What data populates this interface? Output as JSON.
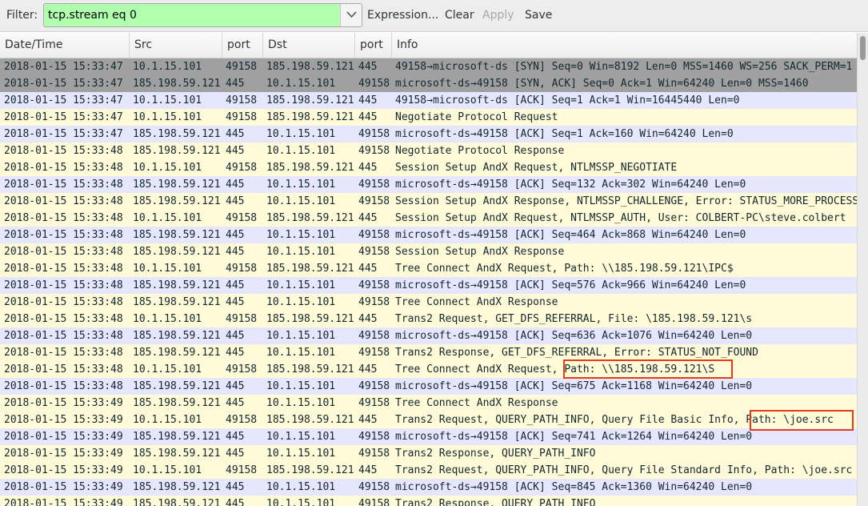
{
  "toolbar": {
    "filter_label": "Filter:",
    "filter_value": "tcp.stream eq 0",
    "filter_bg": "#afffaf",
    "expression_label": "Expression...",
    "clear_label": "Clear",
    "apply_label": "Apply",
    "save_label": "Save"
  },
  "columns": [
    "Date/Time",
    "Src",
    "port",
    "Dst",
    "port",
    "Info"
  ],
  "row_colors": {
    "gray": "#a0a0a0",
    "lavender": "#e7e6ff",
    "yellow": "#fffbd8",
    "highlight_box": "#e53b17"
  },
  "packets": [
    {
      "time": "2018-01-15 15:33:47",
      "src": "10.1.15.101",
      "sport": "49158",
      "dst": "185.198.59.121",
      "dport": "445",
      "info": "49158→microsoft-ds [SYN] Seq=0 Win=8192 Len=0 MSS=1460 WS=256 SACK_PERM=1",
      "color": "gray"
    },
    {
      "time": "2018-01-15 15:33:47",
      "src": "185.198.59.121",
      "sport": "445",
      "dst": "10.1.15.101",
      "dport": "49158",
      "info": "microsoft-ds→49158 [SYN, ACK] Seq=0 Ack=1 Win=64240 Len=0 MSS=1460",
      "color": "gray"
    },
    {
      "time": "2018-01-15 15:33:47",
      "src": "10.1.15.101",
      "sport": "49158",
      "dst": "185.198.59.121",
      "dport": "445",
      "info": "49158→microsoft-ds [ACK] Seq=1 Ack=1 Win=16445440 Len=0",
      "color": "lavender"
    },
    {
      "time": "2018-01-15 15:33:47",
      "src": "10.1.15.101",
      "sport": "49158",
      "dst": "185.198.59.121",
      "dport": "445",
      "info": "Negotiate Protocol Request",
      "color": "yellow"
    },
    {
      "time": "2018-01-15 15:33:47",
      "src": "185.198.59.121",
      "sport": "445",
      "dst": "10.1.15.101",
      "dport": "49158",
      "info": "microsoft-ds→49158 [ACK] Seq=1 Ack=160 Win=64240 Len=0",
      "color": "lavender"
    },
    {
      "time": "2018-01-15 15:33:48",
      "src": "185.198.59.121",
      "sport": "445",
      "dst": "10.1.15.101",
      "dport": "49158",
      "info": "Negotiate Protocol Response",
      "color": "yellow"
    },
    {
      "time": "2018-01-15 15:33:48",
      "src": "10.1.15.101",
      "sport": "49158",
      "dst": "185.198.59.121",
      "dport": "445",
      "info": "Session Setup AndX Request, NTLMSSP_NEGOTIATE",
      "color": "yellow"
    },
    {
      "time": "2018-01-15 15:33:48",
      "src": "185.198.59.121",
      "sport": "445",
      "dst": "10.1.15.101",
      "dport": "49158",
      "info": "microsoft-ds→49158 [ACK] Seq=132 Ack=302 Win=64240 Len=0",
      "color": "lavender"
    },
    {
      "time": "2018-01-15 15:33:48",
      "src": "185.198.59.121",
      "sport": "445",
      "dst": "10.1.15.101",
      "dport": "49158",
      "info": "Session Setup AndX Response, NTLMSSP_CHALLENGE, Error: STATUS_MORE_PROCESSING_REQUIRED",
      "color": "yellow"
    },
    {
      "time": "2018-01-15 15:33:48",
      "src": "10.1.15.101",
      "sport": "49158",
      "dst": "185.198.59.121",
      "dport": "445",
      "info": "Session Setup AndX Request, NTLMSSP_AUTH, User: COLBERT-PC\\steve.colbert",
      "color": "yellow"
    },
    {
      "time": "2018-01-15 15:33:48",
      "src": "185.198.59.121",
      "sport": "445",
      "dst": "10.1.15.101",
      "dport": "49158",
      "info": "microsoft-ds→49158 [ACK] Seq=464 Ack=868 Win=64240 Len=0",
      "color": "lavender"
    },
    {
      "time": "2018-01-15 15:33:48",
      "src": "185.198.59.121",
      "sport": "445",
      "dst": "10.1.15.101",
      "dport": "49158",
      "info": "Session Setup AndX Response",
      "color": "yellow"
    },
    {
      "time": "2018-01-15 15:33:48",
      "src": "10.1.15.101",
      "sport": "49158",
      "dst": "185.198.59.121",
      "dport": "445",
      "info": "Tree Connect AndX Request, Path: \\\\185.198.59.121\\IPC$",
      "color": "yellow"
    },
    {
      "time": "2018-01-15 15:33:48",
      "src": "185.198.59.121",
      "sport": "445",
      "dst": "10.1.15.101",
      "dport": "49158",
      "info": "microsoft-ds→49158 [ACK] Seq=576 Ack=966 Win=64240 Len=0",
      "color": "lavender"
    },
    {
      "time": "2018-01-15 15:33:48",
      "src": "185.198.59.121",
      "sport": "445",
      "dst": "10.1.15.101",
      "dport": "49158",
      "info": "Tree Connect AndX Response",
      "color": "yellow"
    },
    {
      "time": "2018-01-15 15:33:48",
      "src": "10.1.15.101",
      "sport": "49158",
      "dst": "185.198.59.121",
      "dport": "445",
      "info": "Trans2 Request, GET_DFS_REFERRAL, File: \\185.198.59.121\\s",
      "color": "yellow"
    },
    {
      "time": "2018-01-15 15:33:48",
      "src": "185.198.59.121",
      "sport": "445",
      "dst": "10.1.15.101",
      "dport": "49158",
      "info": "microsoft-ds→49158 [ACK] Seq=636 Ack=1076 Win=64240 Len=0",
      "color": "lavender"
    },
    {
      "time": "2018-01-15 15:33:48",
      "src": "185.198.59.121",
      "sport": "445",
      "dst": "10.1.15.101",
      "dport": "49158",
      "info": "Trans2 Response, GET_DFS_REFERRAL, Error: STATUS_NOT_FOUND",
      "color": "yellow"
    },
    {
      "time": "2018-01-15 15:33:48",
      "src": "10.1.15.101",
      "sport": "49158",
      "dst": "185.198.59.121",
      "dport": "445",
      "info": "Tree Connect AndX Request, Path: \\\\185.198.59.121\\S",
      "color": "yellow"
    },
    {
      "time": "2018-01-15 15:33:48",
      "src": "185.198.59.121",
      "sport": "445",
      "dst": "10.1.15.101",
      "dport": "49158",
      "info": "microsoft-ds→49158 [ACK] Seq=675 Ack=1168 Win=64240 Len=0",
      "color": "lavender"
    },
    {
      "time": "2018-01-15 15:33:49",
      "src": "185.198.59.121",
      "sport": "445",
      "dst": "10.1.15.101",
      "dport": "49158",
      "info": "Tree Connect AndX Response",
      "color": "yellow"
    },
    {
      "time": "2018-01-15 15:33:49",
      "src": "10.1.15.101",
      "sport": "49158",
      "dst": "185.198.59.121",
      "dport": "445",
      "info": "Trans2 Request, QUERY_PATH_INFO, Query File Basic Info, Path: \\joe.src",
      "color": "yellow"
    },
    {
      "time": "2018-01-15 15:33:49",
      "src": "185.198.59.121",
      "sport": "445",
      "dst": "10.1.15.101",
      "dport": "49158",
      "info": "microsoft-ds→49158 [ACK] Seq=741 Ack=1264 Win=64240 Len=0",
      "color": "lavender"
    },
    {
      "time": "2018-01-15 15:33:49",
      "src": "185.198.59.121",
      "sport": "445",
      "dst": "10.1.15.101",
      "dport": "49158",
      "info": "Trans2 Response, QUERY_PATH_INFO",
      "color": "yellow"
    },
    {
      "time": "2018-01-15 15:33:49",
      "src": "10.1.15.101",
      "sport": "49158",
      "dst": "185.198.59.121",
      "dport": "445",
      "info": "Trans2 Request, QUERY_PATH_INFO, Query File Standard Info, Path: \\joe.src",
      "color": "yellow"
    },
    {
      "time": "2018-01-15 15:33:49",
      "src": "185.198.59.121",
      "sport": "445",
      "dst": "10.1.15.101",
      "dport": "49158",
      "info": "microsoft-ds→49158 [ACK] Seq=845 Ack=1360 Win=64240 Len=0",
      "color": "lavender"
    },
    {
      "time": "2018-01-15 15:33:49",
      "src": "185.198.59.121",
      "sport": "445",
      "dst": "10.1.15.101",
      "dport": "49158",
      "info": "Trans2 Response, QUERY_PATH_INFO",
      "color": "yellow"
    }
  ]
}
